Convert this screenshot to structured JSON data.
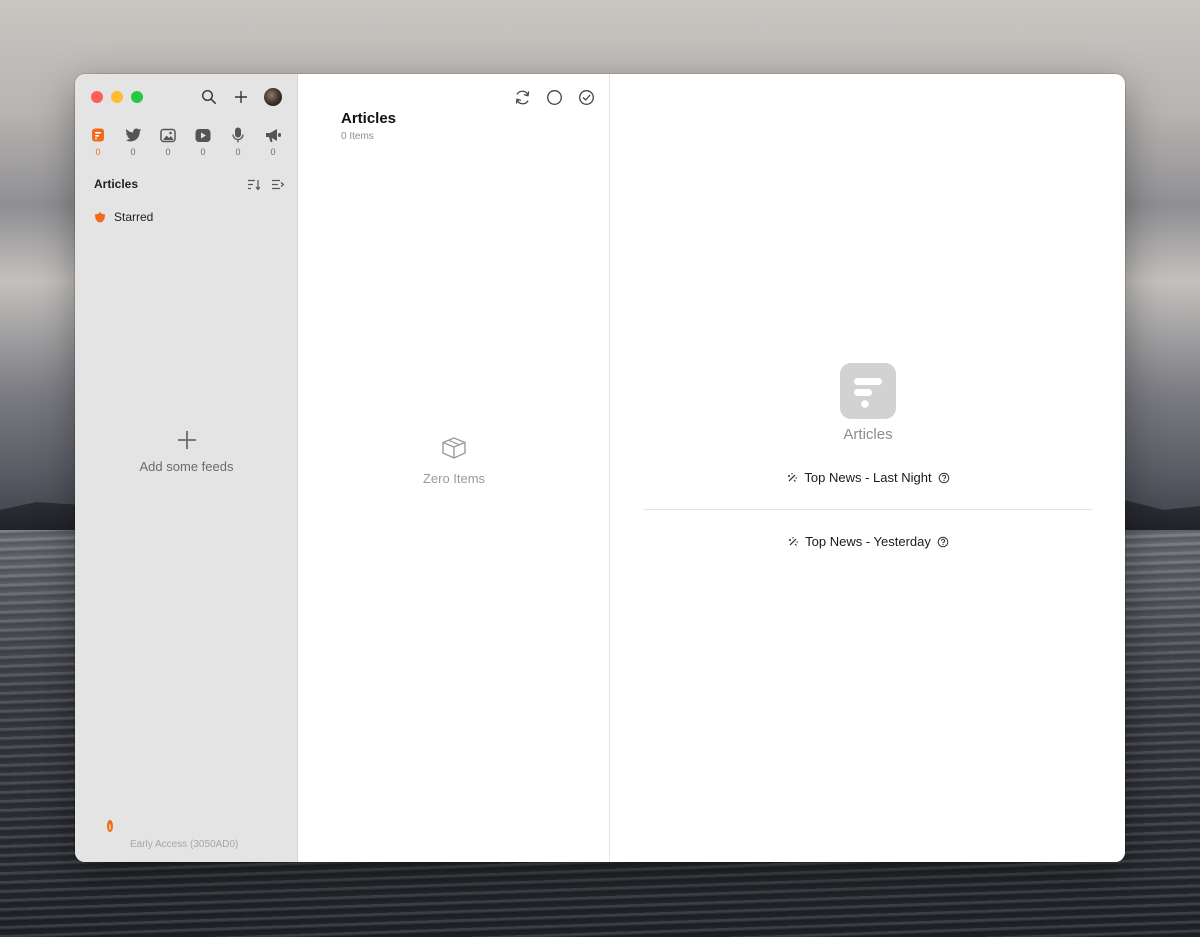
{
  "sidebar": {
    "feed_types": [
      {
        "name": "articles",
        "icon": "articles-icon",
        "count": "0",
        "active": true
      },
      {
        "name": "social",
        "icon": "twitter-icon",
        "count": "0"
      },
      {
        "name": "pictures",
        "icon": "image-icon",
        "count": "0"
      },
      {
        "name": "videos",
        "icon": "video-icon",
        "count": "0"
      },
      {
        "name": "audio",
        "icon": "microphone-icon",
        "count": "0"
      },
      {
        "name": "notifications",
        "icon": "megaphone-icon",
        "count": "0"
      }
    ],
    "section_title": "Articles",
    "starred_label": "Starred",
    "add_feeds_label": "Add some feeds",
    "version_label": "Early Access (3050AD0)"
  },
  "list": {
    "title": "Articles",
    "count_label": "0 Items",
    "empty_label": "Zero Items"
  },
  "detail": {
    "title": "Articles",
    "top_news": [
      {
        "label": "Top News - Last Night"
      },
      {
        "label": "Top News - Yesterday"
      }
    ]
  },
  "colors": {
    "accent": "#f46a1c",
    "sidebar_bg": "#e4e4e4",
    "traffic_red": "#fe5f57",
    "traffic_yellow": "#febc2e",
    "traffic_green": "#28c840"
  }
}
